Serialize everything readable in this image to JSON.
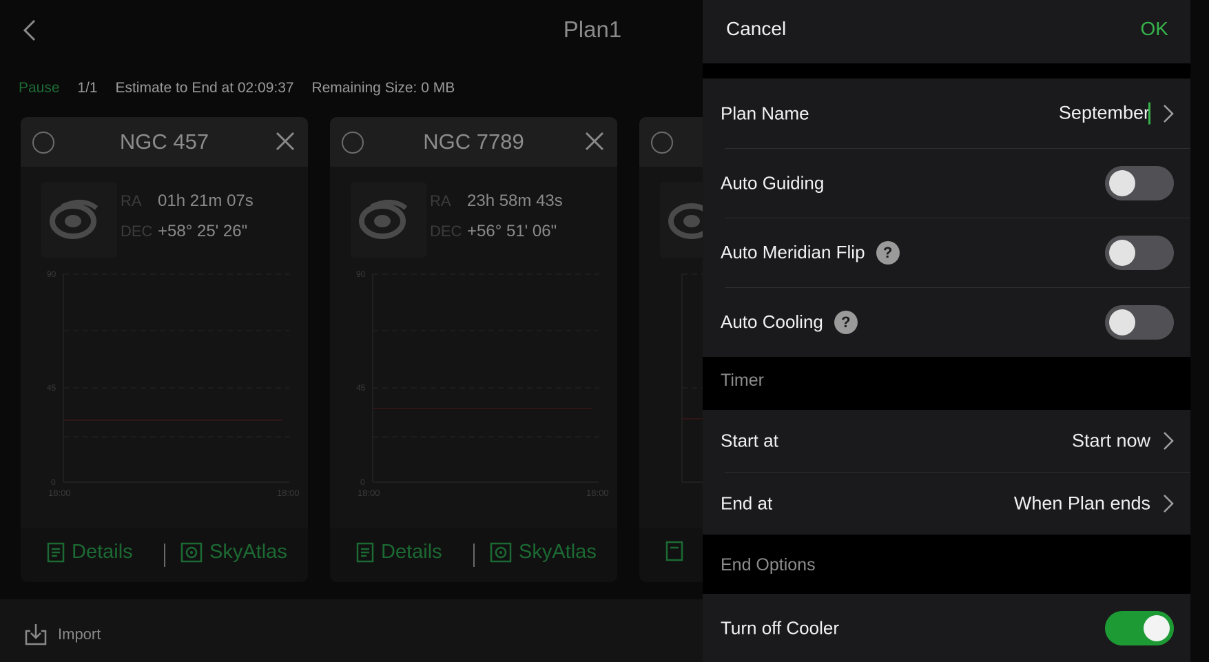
{
  "background": {
    "title": "Plan1",
    "status": {
      "state": "Pause",
      "count": "1/1",
      "estimate": "Estimate to End at 02:09:37",
      "remaining": "Remaining Size: 0 MB"
    },
    "cards": [
      {
        "name": "NGC 457",
        "ra_label": "RA",
        "ra": "01h 21m 07s",
        "dec_label": "DEC",
        "dec": "+58° 25' 26\"",
        "y_ticks": [
          "90",
          "45",
          "0"
        ],
        "x_ticks": [
          "18:00",
          "18:00"
        ],
        "details_label": "Details",
        "skyatlas_label": "SkyAtlas"
      },
      {
        "name": "NGC 7789",
        "ra_label": "RA",
        "ra": "23h 58m 43s",
        "dec_label": "DEC",
        "dec": "+56° 51' 06\"",
        "y_ticks": [
          "90",
          "45",
          "0"
        ],
        "x_ticks": [
          "18:00",
          "18:00"
        ],
        "details_label": "Details",
        "skyatlas_label": "SkyAtlas"
      }
    ],
    "import_label": "Import"
  },
  "panel": {
    "cancel_label": "Cancel",
    "ok_label": "OK",
    "plan_name_label": "Plan Name",
    "plan_name_value": "September",
    "auto_guiding_label": "Auto Guiding",
    "auto_guiding_on": false,
    "auto_meridian_flip_label": "Auto Meridian Flip",
    "auto_meridian_flip_on": false,
    "auto_cooling_label": "Auto Cooling",
    "auto_cooling_on": false,
    "help_glyph": "?",
    "timer_section": "Timer",
    "start_at_label": "Start at",
    "start_at_value": "Start now",
    "end_at_label": "End at",
    "end_at_value": "When Plan ends",
    "end_options_section": "End Options",
    "turn_off_cooler_label": "Turn off Cooler",
    "turn_off_cooler_on": true
  },
  "colors": {
    "accent_green": "#36b34a",
    "toggle_on": "#1e9a35",
    "panel_bg": "#1a1a1c"
  }
}
